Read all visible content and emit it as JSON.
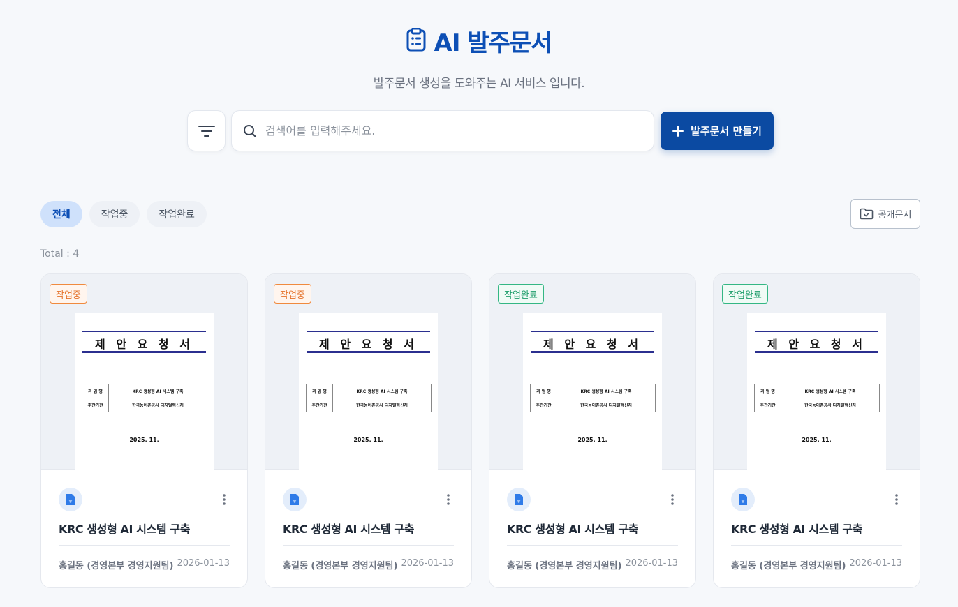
{
  "header": {
    "title": "AI 발주문서",
    "subtitle": "발주문서 생성을 도와주는 AI 서비스 입니다."
  },
  "search": {
    "placeholder": "검색어를 입력해주세요.",
    "value": ""
  },
  "create_button": {
    "label": "발주문서 만들기"
  },
  "tabs": [
    {
      "label": "전체",
      "active": true
    },
    {
      "label": "작업중",
      "active": false
    },
    {
      "label": "작업완료",
      "active": false
    }
  ],
  "public_button": {
    "label": "공개문서"
  },
  "total": "Total : 4",
  "colors": {
    "brand": "#0d4fb5",
    "button": "#0b4aa2",
    "working": "#e5722a",
    "done": "#1e9e6b"
  },
  "cards": [
    {
      "status": "작업중",
      "status_type": "working",
      "thumbnail": {
        "doc_title": "제 안 요 청 서",
        "row1_key": "과 업 명",
        "row1_value": "KRC 생성형 AI 시스템 구축",
        "row2_key": "주관기관",
        "row2_value": "한국농어촌공사 디지털혁신처",
        "date": "2025. 11."
      },
      "title": "KRC 생성형  AI 시스템 구축",
      "author": "홍길동 (경영본부 경영지원팀)",
      "date": "2026-01-13"
    },
    {
      "status": "작업중",
      "status_type": "working",
      "thumbnail": {
        "doc_title": "제 안 요 청 서",
        "row1_key": "과 업 명",
        "row1_value": "KRC 생성형 AI 시스템 구축",
        "row2_key": "주관기관",
        "row2_value": "한국농어촌공사 디지털혁신처",
        "date": "2025. 11."
      },
      "title": "KRC 생성형  AI 시스템 구축",
      "author": "홍길동 (경영본부 경영지원팀)",
      "date": "2026-01-13"
    },
    {
      "status": "작업완료",
      "status_type": "done",
      "thumbnail": {
        "doc_title": "제 안 요 청 서",
        "row1_key": "과 업 명",
        "row1_value": "KRC 생성형 AI 시스템 구축",
        "row2_key": "주관기관",
        "row2_value": "한국농어촌공사 디지털혁신처",
        "date": "2025. 11."
      },
      "title": "KRC 생성형  AI 시스템 구축",
      "author": "홍길동 (경영본부 경영지원팀)",
      "date": "2026-01-13"
    },
    {
      "status": "작업완료",
      "status_type": "done",
      "thumbnail": {
        "doc_title": "제 안 요 청 서",
        "row1_key": "과 업 명",
        "row1_value": "KRC 생성형 AI 시스템 구축",
        "row2_key": "주관기관",
        "row2_value": "한국농어촌공사 디지털혁신처",
        "date": "2025. 11."
      },
      "title": "KRC 생성형  AI 시스템 구축",
      "author": "홍길동 (경영본부 경영지원팀)",
      "date": "2026-01-13"
    }
  ]
}
